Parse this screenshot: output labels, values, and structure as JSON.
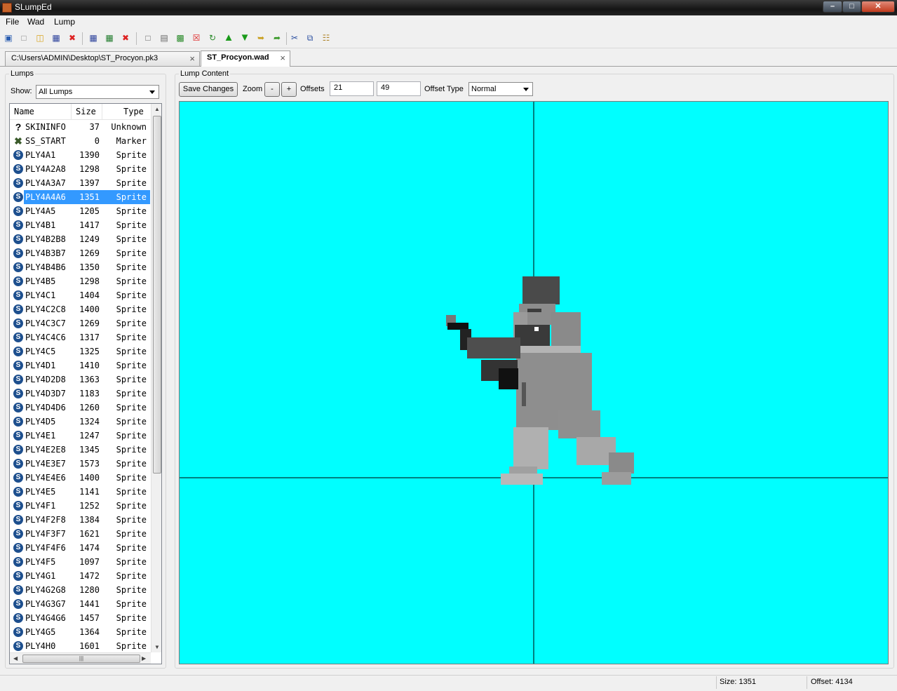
{
  "window": {
    "title": "SLumpEd"
  },
  "menu": [
    "File",
    "Wad",
    "Lump"
  ],
  "toolbar_icons": [
    "new-wad-icon",
    "new-file-icon",
    "open-icon",
    "save-all-icon",
    "close-all-icon",
    "save-icon",
    "save-as-icon",
    "close-icon",
    "new-lump-icon",
    "new-lump-file-icon",
    "import-lump-icon",
    "delete-lump-icon",
    "rename-lump-icon",
    "move-up-icon",
    "move-down-icon",
    "import-icon",
    "export-icon",
    "cut-icon",
    "copy-icon",
    "paste-icon"
  ],
  "tabs": [
    {
      "label": "C:\\Users\\ADMIN\\Desktop\\ST_Procyon.pk3",
      "active": false
    },
    {
      "label": "ST_Procyon.wad",
      "active": true
    }
  ],
  "lumps_panel": {
    "label": "Lumps",
    "show_label": "Show:",
    "filter_value": "All Lumps",
    "columns": [
      "Name",
      "Size",
      "Type"
    ],
    "rows": [
      {
        "name": "SKININFO",
        "size": "37",
        "type": "Unknown",
        "icon": "unknown"
      },
      {
        "name": "SS_START",
        "size": "0",
        "type": "Marker",
        "icon": "marker"
      },
      {
        "name": "PLY4A1",
        "size": "1390",
        "type": "Sprite",
        "icon": "sprite"
      },
      {
        "name": "PLY4A2A8",
        "size": "1298",
        "type": "Sprite",
        "icon": "sprite"
      },
      {
        "name": "PLY4A3A7",
        "size": "1397",
        "type": "Sprite",
        "icon": "sprite"
      },
      {
        "name": "PLY4A4A6",
        "size": "1351",
        "type": "Sprite",
        "icon": "sprite",
        "selected": true
      },
      {
        "name": "PLY4A5",
        "size": "1205",
        "type": "Sprite",
        "icon": "sprite"
      },
      {
        "name": "PLY4B1",
        "size": "1417",
        "type": "Sprite",
        "icon": "sprite"
      },
      {
        "name": "PLY4B2B8",
        "size": "1249",
        "type": "Sprite",
        "icon": "sprite"
      },
      {
        "name": "PLY4B3B7",
        "size": "1269",
        "type": "Sprite",
        "icon": "sprite"
      },
      {
        "name": "PLY4B4B6",
        "size": "1350",
        "type": "Sprite",
        "icon": "sprite"
      },
      {
        "name": "PLY4B5",
        "size": "1298",
        "type": "Sprite",
        "icon": "sprite"
      },
      {
        "name": "PLY4C1",
        "size": "1404",
        "type": "Sprite",
        "icon": "sprite"
      },
      {
        "name": "PLY4C2C8",
        "size": "1400",
        "type": "Sprite",
        "icon": "sprite"
      },
      {
        "name": "PLY4C3C7",
        "size": "1269",
        "type": "Sprite",
        "icon": "sprite"
      },
      {
        "name": "PLY4C4C6",
        "size": "1317",
        "type": "Sprite",
        "icon": "sprite"
      },
      {
        "name": "PLY4C5",
        "size": "1325",
        "type": "Sprite",
        "icon": "sprite"
      },
      {
        "name": "PLY4D1",
        "size": "1410",
        "type": "Sprite",
        "icon": "sprite"
      },
      {
        "name": "PLY4D2D8",
        "size": "1363",
        "type": "Sprite",
        "icon": "sprite"
      },
      {
        "name": "PLY4D3D7",
        "size": "1183",
        "type": "Sprite",
        "icon": "sprite"
      },
      {
        "name": "PLY4D4D6",
        "size": "1260",
        "type": "Sprite",
        "icon": "sprite"
      },
      {
        "name": "PLY4D5",
        "size": "1324",
        "type": "Sprite",
        "icon": "sprite"
      },
      {
        "name": "PLY4E1",
        "size": "1247",
        "type": "Sprite",
        "icon": "sprite"
      },
      {
        "name": "PLY4E2E8",
        "size": "1345",
        "type": "Sprite",
        "icon": "sprite"
      },
      {
        "name": "PLY4E3E7",
        "size": "1573",
        "type": "Sprite",
        "icon": "sprite"
      },
      {
        "name": "PLY4E4E6",
        "size": "1400",
        "type": "Sprite",
        "icon": "sprite"
      },
      {
        "name": "PLY4E5",
        "size": "1141",
        "type": "Sprite",
        "icon": "sprite"
      },
      {
        "name": "PLY4F1",
        "size": "1252",
        "type": "Sprite",
        "icon": "sprite"
      },
      {
        "name": "PLY4F2F8",
        "size": "1384",
        "type": "Sprite",
        "icon": "sprite"
      },
      {
        "name": "PLY4F3F7",
        "size": "1621",
        "type": "Sprite",
        "icon": "sprite"
      },
      {
        "name": "PLY4F4F6",
        "size": "1474",
        "type": "Sprite",
        "icon": "sprite"
      },
      {
        "name": "PLY4F5",
        "size": "1097",
        "type": "Sprite",
        "icon": "sprite"
      },
      {
        "name": "PLY4G1",
        "size": "1472",
        "type": "Sprite",
        "icon": "sprite"
      },
      {
        "name": "PLY4G2G8",
        "size": "1280",
        "type": "Sprite",
        "icon": "sprite"
      },
      {
        "name": "PLY4G3G7",
        "size": "1441",
        "type": "Sprite",
        "icon": "sprite"
      },
      {
        "name": "PLY4G4G6",
        "size": "1457",
        "type": "Sprite",
        "icon": "sprite"
      },
      {
        "name": "PLY4G5",
        "size": "1364",
        "type": "Sprite",
        "icon": "sprite"
      },
      {
        "name": "PLY4H0",
        "size": "1601",
        "type": "Sprite",
        "icon": "sprite"
      }
    ]
  },
  "content_panel": {
    "label": "Lump Content",
    "save_label": "Save Changes",
    "zoom_label": "Zoom",
    "zoom_out": "-",
    "zoom_in": "+",
    "offsets_label": "Offsets",
    "offset_x": "21",
    "offset_y": "49",
    "offset_type_label": "Offset Type",
    "offset_type_value": "Normal",
    "canvas_color": "#00ffff"
  },
  "status": {
    "size": "Size: 1351",
    "offset": "Offset: 4134"
  }
}
